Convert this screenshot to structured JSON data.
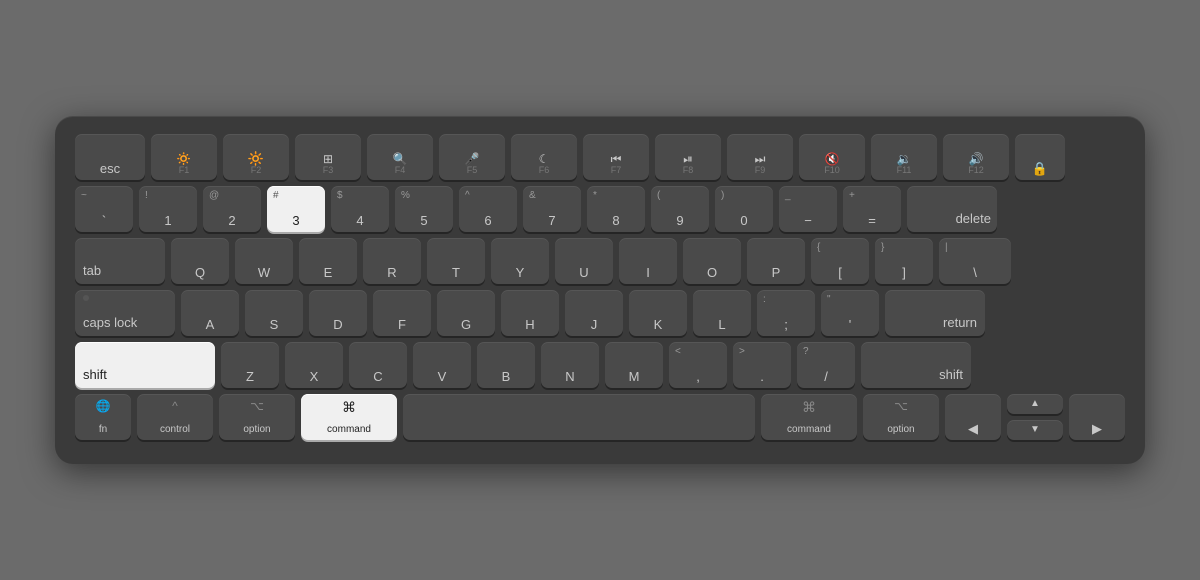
{
  "keyboard": {
    "background": "#3a3a3a",
    "rows": {
      "row1": {
        "keys": [
          {
            "id": "esc",
            "label": "esc",
            "width": "esc"
          },
          {
            "id": "f1",
            "icon": "☀",
            "label": "F1",
            "width": "f"
          },
          {
            "id": "f2",
            "icon": "☀",
            "label": "F2",
            "width": "f"
          },
          {
            "id": "f3",
            "icon": "⊞",
            "label": "F3",
            "width": "f"
          },
          {
            "id": "f4",
            "icon": "⌕",
            "label": "F4",
            "width": "f"
          },
          {
            "id": "f5",
            "icon": "⏺",
            "label": "F5",
            "width": "f"
          },
          {
            "id": "f6",
            "icon": "☾",
            "label": "F6",
            "width": "f"
          },
          {
            "id": "f7",
            "icon": "⏮",
            "label": "F7",
            "width": "f"
          },
          {
            "id": "f8",
            "icon": "⏯",
            "label": "F8",
            "width": "f"
          },
          {
            "id": "f9",
            "icon": "⏭",
            "label": "F9",
            "width": "f"
          },
          {
            "id": "f10",
            "icon": "◁",
            "label": "F10",
            "width": "f"
          },
          {
            "id": "f11",
            "icon": "◁◁",
            "label": "F11",
            "width": "f"
          },
          {
            "id": "f12",
            "icon": "▷▷",
            "label": "F12",
            "width": "f"
          },
          {
            "id": "lock",
            "icon": "🔒",
            "label": "",
            "width": "lock"
          }
        ]
      },
      "row2": {
        "keys": [
          {
            "id": "tilde",
            "top": "~",
            "main": "`",
            "width": "tilde"
          },
          {
            "id": "1",
            "top": "!",
            "main": "1",
            "width": "num"
          },
          {
            "id": "2",
            "top": "@",
            "main": "2",
            "width": "num"
          },
          {
            "id": "3",
            "top": "#",
            "main": "3",
            "width": "num",
            "active": true
          },
          {
            "id": "4",
            "top": "$",
            "main": "4",
            "width": "num"
          },
          {
            "id": "5",
            "top": "%",
            "main": "5",
            "width": "num"
          },
          {
            "id": "6",
            "top": "^",
            "main": "6",
            "width": "num"
          },
          {
            "id": "7",
            "top": "&",
            "main": "7",
            "width": "num"
          },
          {
            "id": "8",
            "top": "*",
            "main": "8",
            "width": "num"
          },
          {
            "id": "9",
            "top": "(",
            "main": "9",
            "width": "num"
          },
          {
            "id": "0",
            "top": ")",
            "main": "0",
            "width": "num"
          },
          {
            "id": "minus",
            "top": "_",
            "main": "−",
            "width": "num"
          },
          {
            "id": "equals",
            "top": "+",
            "main": "=",
            "width": "num"
          },
          {
            "id": "delete",
            "label": "delete",
            "width": "delete"
          }
        ]
      },
      "row3": {
        "keys": [
          {
            "id": "tab",
            "label": "tab",
            "width": "tab"
          },
          {
            "id": "q",
            "main": "Q",
            "width": "num"
          },
          {
            "id": "w",
            "main": "W",
            "width": "num"
          },
          {
            "id": "e",
            "main": "E",
            "width": "num"
          },
          {
            "id": "r",
            "main": "R",
            "width": "num"
          },
          {
            "id": "t",
            "main": "T",
            "width": "num"
          },
          {
            "id": "y",
            "main": "Y",
            "width": "num"
          },
          {
            "id": "u",
            "main": "U",
            "width": "num"
          },
          {
            "id": "i",
            "main": "I",
            "width": "num"
          },
          {
            "id": "o",
            "main": "O",
            "width": "num"
          },
          {
            "id": "p",
            "main": "P",
            "width": "num"
          },
          {
            "id": "lbrace",
            "top": "{",
            "main": "[",
            "width": "num"
          },
          {
            "id": "rbrace",
            "top": "}",
            "main": "]",
            "width": "num"
          },
          {
            "id": "backslash",
            "top": "|",
            "main": "\\",
            "width": "backslash"
          }
        ]
      },
      "row4": {
        "keys": [
          {
            "id": "capslock",
            "label": "caps lock",
            "dot": true,
            "width": "capslock"
          },
          {
            "id": "a",
            "main": "A",
            "width": "num"
          },
          {
            "id": "s",
            "main": "S",
            "width": "num"
          },
          {
            "id": "d",
            "main": "D",
            "width": "num"
          },
          {
            "id": "f",
            "main": "F",
            "width": "num"
          },
          {
            "id": "g",
            "main": "G",
            "width": "num"
          },
          {
            "id": "h",
            "main": "H",
            "width": "num"
          },
          {
            "id": "j",
            "main": "J",
            "width": "num"
          },
          {
            "id": "k",
            "main": "K",
            "width": "num"
          },
          {
            "id": "l",
            "main": "L",
            "width": "num"
          },
          {
            "id": "semicolon",
            "top": ":",
            "main": ";",
            "width": "num"
          },
          {
            "id": "quote",
            "top": "\"",
            "main": "'",
            "width": "num"
          },
          {
            "id": "return",
            "label": "return",
            "width": "return"
          }
        ]
      },
      "row5": {
        "keys": [
          {
            "id": "shift-l",
            "label": "shift",
            "width": "shift-l",
            "active": true
          },
          {
            "id": "z",
            "main": "Z",
            "width": "num"
          },
          {
            "id": "x",
            "main": "X",
            "width": "num"
          },
          {
            "id": "c",
            "main": "C",
            "width": "num"
          },
          {
            "id": "v",
            "main": "V",
            "width": "num"
          },
          {
            "id": "b",
            "main": "B",
            "width": "num"
          },
          {
            "id": "n",
            "main": "N",
            "width": "num"
          },
          {
            "id": "m",
            "main": "M",
            "width": "num"
          },
          {
            "id": "comma",
            "top": "<",
            "main": ",",
            "width": "num"
          },
          {
            "id": "period",
            "top": ">",
            "main": ".",
            "width": "num"
          },
          {
            "id": "slash",
            "top": "?",
            "main": "/",
            "width": "num"
          },
          {
            "id": "shift-r",
            "label": "shift",
            "width": "shift-r"
          }
        ]
      },
      "row6": {
        "keys": [
          {
            "id": "fn",
            "label": "fn",
            "icon": "🌐",
            "width": "fn-key"
          },
          {
            "id": "control",
            "label": "control",
            "icon": "^",
            "width": "control"
          },
          {
            "id": "option-l",
            "label": "option",
            "icon": "⌥",
            "width": "option"
          },
          {
            "id": "command-l",
            "label": "command",
            "icon": "⌘",
            "width": "command-l",
            "active": true
          },
          {
            "id": "space",
            "label": "",
            "width": "space"
          },
          {
            "id": "command-r",
            "label": "command",
            "icon": "⌘",
            "width": "command-r"
          },
          {
            "id": "option-r",
            "label": "option",
            "icon": "⌥",
            "width": "option-r"
          },
          {
            "id": "arrow-left",
            "icon": "◀",
            "width": "arrow-lr"
          },
          {
            "id": "arrow-up-down",
            "width": "arrow-lr"
          },
          {
            "id": "arrow-right",
            "icon": "▶",
            "width": "arrow-lr"
          }
        ]
      }
    }
  }
}
